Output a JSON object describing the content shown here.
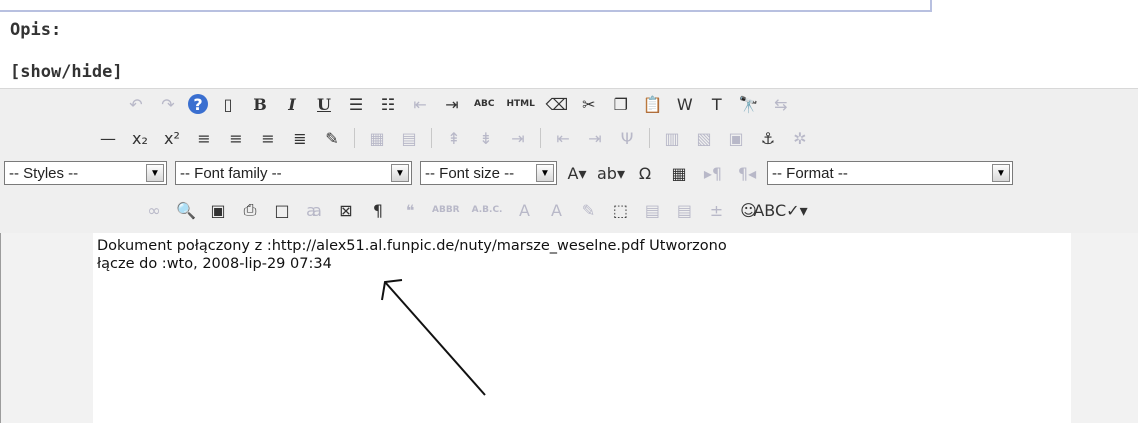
{
  "labels": {
    "opis": "Opis:",
    "show_hide": "[show/hide]"
  },
  "toolbar": {
    "row1": [
      {
        "name": "undo-icon",
        "glyph": "↶",
        "dim": true
      },
      {
        "name": "redo-icon",
        "glyph": "↷",
        "dim": true
      },
      {
        "name": "help-icon",
        "glyph": "?",
        "style": "help"
      },
      {
        "name": "new-document-icon",
        "glyph": "▯"
      },
      {
        "name": "bold-button",
        "glyph": "B",
        "style": "bold"
      },
      {
        "name": "italic-button",
        "glyph": "I",
        "style": "italic"
      },
      {
        "name": "underline-button",
        "glyph": "U",
        "style": "underline"
      },
      {
        "name": "bullet-list-icon",
        "glyph": "☰"
      },
      {
        "name": "numbered-list-icon",
        "glyph": "☷"
      },
      {
        "name": "outdent-icon",
        "glyph": "⇤",
        "dim": true
      },
      {
        "name": "indent-icon",
        "glyph": "⇥"
      },
      {
        "name": "spellcheck-abc-button",
        "text": "ABC",
        "small": true
      },
      {
        "name": "html-button",
        "text": "HTML",
        "small": true
      },
      {
        "name": "eraser-icon",
        "glyph": "⌫"
      },
      {
        "name": "cut-icon",
        "glyph": "✂"
      },
      {
        "name": "copy-icon",
        "glyph": "❐"
      },
      {
        "name": "paste-icon",
        "glyph": "📋"
      },
      {
        "name": "paste-word-icon",
        "glyph": "W"
      },
      {
        "name": "paste-text-icon",
        "glyph": "T"
      },
      {
        "name": "find-icon",
        "glyph": "🔭"
      },
      {
        "name": "replace-icon",
        "glyph": "⇆",
        "dim": true
      }
    ],
    "row2": [
      {
        "name": "horizontal-rule-icon",
        "glyph": "—"
      },
      {
        "name": "subscript-button",
        "glyph": "x₂"
      },
      {
        "name": "superscript-button",
        "glyph": "x²"
      },
      {
        "name": "align-left-icon",
        "glyph": "≡"
      },
      {
        "name": "align-center-icon",
        "glyph": "≡"
      },
      {
        "name": "align-right-icon",
        "glyph": "≡"
      },
      {
        "name": "align-justify-icon",
        "glyph": "≣"
      },
      {
        "name": "edit-icon",
        "glyph": "✎"
      },
      {
        "sep": true
      },
      {
        "name": "table-insert-icon",
        "glyph": "▦",
        "dim": true
      },
      {
        "name": "table-props-icon",
        "glyph": "▤",
        "dim": true
      },
      {
        "sep": true
      },
      {
        "name": "row-before-icon",
        "glyph": "⇞",
        "dim": true
      },
      {
        "name": "row-after-icon",
        "glyph": "⇟",
        "dim": true
      },
      {
        "name": "delete-row-icon",
        "glyph": "⇥",
        "dim": true
      },
      {
        "sep": true
      },
      {
        "name": "col-before-icon",
        "glyph": "⇤",
        "dim": true
      },
      {
        "name": "col-after-icon",
        "glyph": "⇥",
        "dim": true
      },
      {
        "name": "delete-col-icon",
        "glyph": "Ψ",
        "dim": true
      },
      {
        "sep": true
      },
      {
        "name": "split-cells-icon",
        "glyph": "▥",
        "dim": true
      },
      {
        "name": "merge-cells-icon",
        "glyph": "▧",
        "dim": true
      },
      {
        "name": "cell-props-icon",
        "glyph": "▣",
        "dim": true
      },
      {
        "name": "anchor-icon",
        "glyph": "⚓"
      },
      {
        "name": "link-break-icon",
        "glyph": "✲",
        "dim": true
      }
    ],
    "selects": {
      "styles": "-- Styles --",
      "font_family": "-- Font family --",
      "font_size": "-- Font size --",
      "format": "-- Format --"
    },
    "row3_icons": [
      {
        "name": "font-color-icon",
        "glyph": "A▾"
      },
      {
        "name": "highlight-color-icon",
        "glyph": "ab▾"
      },
      {
        "name": "special-char-icon",
        "glyph": "Ω"
      },
      {
        "name": "visual-aid-icon",
        "glyph": "▦"
      },
      {
        "name": "ltr-icon",
        "glyph": "▸¶",
        "dim": true
      },
      {
        "name": "rtl-icon",
        "glyph": "¶◂",
        "dim": true
      }
    ],
    "row4": [
      {
        "name": "link-icon",
        "glyph": "∞",
        "dim": true
      },
      {
        "name": "preview-icon",
        "glyph": "🔍"
      },
      {
        "name": "image-icon",
        "glyph": "▣"
      },
      {
        "name": "print-icon",
        "glyph": "⎙"
      },
      {
        "name": "fullscreen-icon",
        "glyph": "□"
      },
      {
        "name": "style-icon",
        "glyph": "ꜳ",
        "dim": true
      },
      {
        "name": "nonbreaking-icon",
        "glyph": "⊠"
      },
      {
        "name": "paragraph-icon",
        "glyph": "¶"
      },
      {
        "name": "quote-icon",
        "glyph": "❝",
        "dim": true
      },
      {
        "name": "abbr-icon",
        "text": "ABBR",
        "small": true,
        "dim": true
      },
      {
        "name": "acronym-icon",
        "text": "A.B.C.",
        "small": true,
        "dim": true
      },
      {
        "name": "strike-del-icon",
        "glyph": "A",
        "dim": true
      },
      {
        "name": "insert-ins-icon",
        "glyph": "A",
        "dim": true
      },
      {
        "name": "attribs-icon",
        "glyph": "✎",
        "dim": true
      },
      {
        "name": "layer-icon",
        "glyph": "⬚"
      },
      {
        "name": "move-forward-icon",
        "glyph": "▤",
        "dim": true
      },
      {
        "name": "move-backward-icon",
        "glyph": "▤",
        "dim": true
      },
      {
        "name": "absolute-icon",
        "glyph": "±",
        "dim": true
      },
      {
        "name": "emotions-icon",
        "glyph": "☺"
      },
      {
        "name": "spellchecker-icon",
        "glyph": "ABC✓▾"
      }
    ]
  },
  "editor": {
    "line1": "Dokument połączony z :http://alex51.al.funpic.de/nuty/marsze_weselne.pdf Utworzono",
    "line2": "łącze do :wto, 2008-lip-29 07:34"
  }
}
